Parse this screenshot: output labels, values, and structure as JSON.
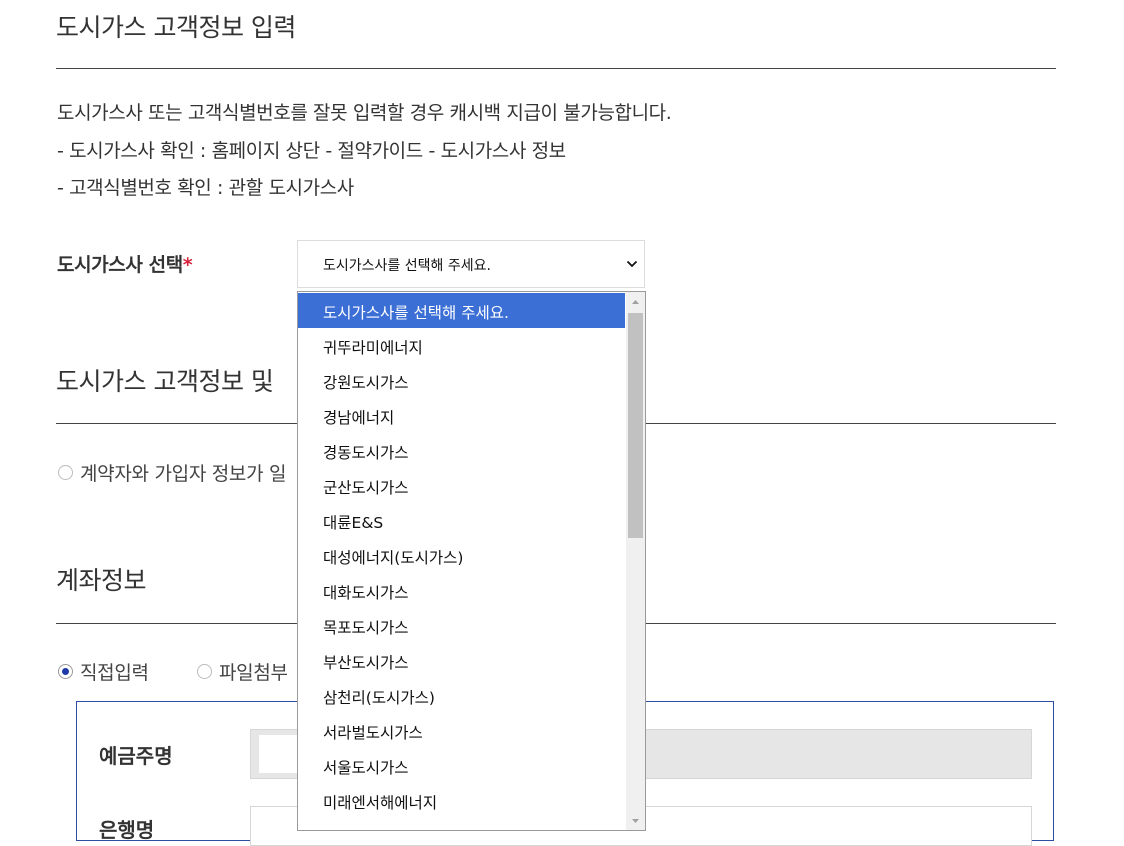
{
  "sections": {
    "customer_info_title": "도시가스 고객정보 입력",
    "customer_and_title": "도시가스 고객정보 및",
    "account_title": "계좌정보"
  },
  "notice": {
    "line1": "도시가스사 또는 고객식별번호를 잘못 입력할 경우 캐시백 지급이 불가능합니다.",
    "line2": "- 도시가스사 확인 : 홈페이지 상단 - 절약가이드 - 도시가스사 정보",
    "line3": "- 고객식별번호 확인 : 관할 도시가스사"
  },
  "gas_company": {
    "label": "도시가스사 선택",
    "required_mark": "*",
    "selected": "도시가스사를 선택해 주세요."
  },
  "dropdown": {
    "options": [
      "도시가스사를 선택해 주세요.",
      "귀뚜라미에너지",
      "강원도시가스",
      "경남에너지",
      "경동도시가스",
      "군산도시가스",
      "대륜E&S",
      "대성에너지(도시가스)",
      "대화도시가스",
      "목포도시가스",
      "부산도시가스",
      "삼천리(도시가스)",
      "서라벌도시가스",
      "서울도시가스",
      "미래엔서해에너지"
    ],
    "selected_index": 0
  },
  "contract_radio": {
    "label": "계약자와 가입자 정보가 일"
  },
  "account": {
    "direct_input_label": "직접입력",
    "file_attach_label": "파일첨부",
    "depositor_label": "예금주명",
    "bank_label": "은행명"
  },
  "colors": {
    "accent_blue": "#3b6fd6",
    "box_border": "#2e4da0",
    "required_red": "#d6223a"
  }
}
